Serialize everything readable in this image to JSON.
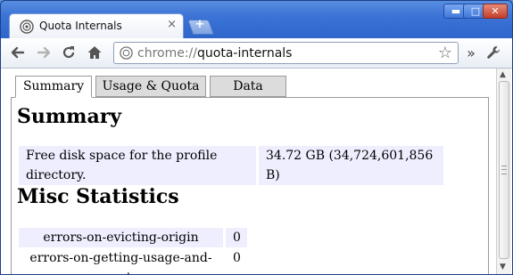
{
  "browser": {
    "tab_title": "Quota Internals",
    "tab_close": "×",
    "new_tab_label": "+",
    "minimize_label": "▬",
    "maximize_label": "□",
    "close_label": "✕",
    "url_scheme": "chrome://",
    "url_path": "quota-internals",
    "overflow_label": "»"
  },
  "page": {
    "tabs": [
      {
        "label": "Summary",
        "active": true
      },
      {
        "label": "Usage & Quota",
        "active": false
      },
      {
        "label": "Data",
        "active": false
      }
    ],
    "summary_heading": "Summary",
    "summary_rows": [
      {
        "label": "Free disk space for the profile directory.",
        "value": "34.72 GB (34,724,601,856 B)"
      }
    ],
    "misc_heading": "Misc Statistics",
    "misc_rows": [
      {
        "label": "errors-on-evicting-origin",
        "value": "0"
      },
      {
        "label": "errors-on-getting-usage-and-quota",
        "value": "0"
      }
    ]
  },
  "colors": {
    "titlebar": "#3b73d6",
    "table_cell_bg": "#eeeeff"
  }
}
